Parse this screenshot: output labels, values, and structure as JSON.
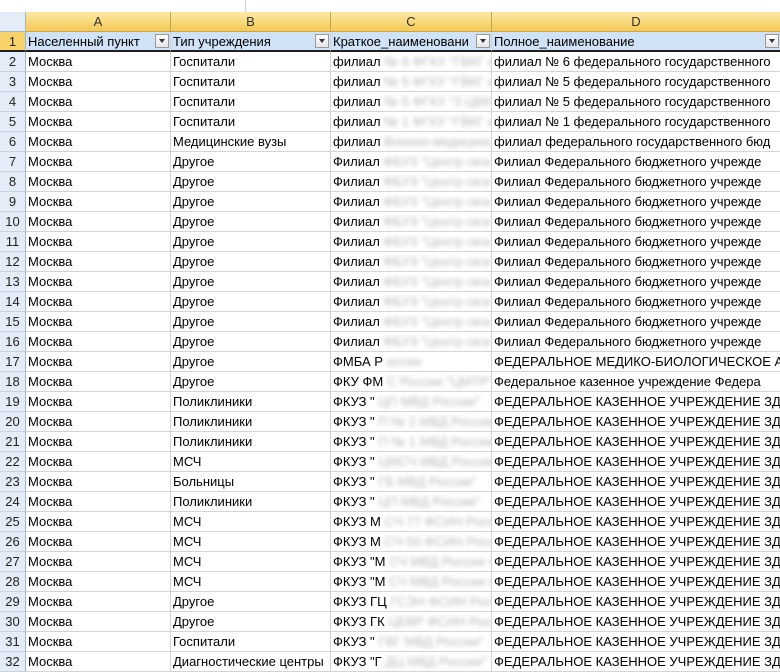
{
  "columns": [
    "A",
    "B",
    "C",
    "D"
  ],
  "headers": [
    "Населенный пункт",
    "Тип учреждения",
    "Краткое_наименовани",
    "Полное_наименование"
  ],
  "rows": [
    {
      "n": "2",
      "a": "Москва",
      "b": "Госпитали",
      "c": "филиал",
      "c_blur": "№ 6 ФГКУ \"ГВКГ и",
      "d": "филиал № 6 федерального государственного"
    },
    {
      "n": "3",
      "a": "Москва",
      "b": "Госпитали",
      "c": "филиал",
      "c_blur": "№ 5 ФГКУ \"ГВКГ и",
      "d": "филиал № 5 федерального государственного"
    },
    {
      "n": "4",
      "a": "Москва",
      "b": "Госпитали",
      "c": "филиал",
      "c_blur": "№ 5 ФГКУ \"3 ЦВКГ",
      "d": "филиал № 5 федерального государственного"
    },
    {
      "n": "5",
      "a": "Москва",
      "b": "Госпитали",
      "c": "филиал",
      "c_blur": "№ 1 ФГКУ \"ГВКГ и",
      "d": "филиал № 1 федерального государственного"
    },
    {
      "n": "6",
      "a": "Москва",
      "b": "Медицинские вузы",
      "c": "филиал",
      "c_blur": "Военно-медицинской",
      "d": "филиал федерального государственного бюд"
    },
    {
      "n": "7",
      "a": "Москва",
      "b": "Другое",
      "c": "Филиал",
      "c_blur": "ФБУЗ \"Центр гиги",
      "d": "Филиал Федерального бюджетного учрежде"
    },
    {
      "n": "8",
      "a": "Москва",
      "b": "Другое",
      "c": "Филиал",
      "c_blur": "ФБУЗ \"Центр гиги",
      "d": "Филиал Федерального бюджетного учрежде"
    },
    {
      "n": "9",
      "a": "Москва",
      "b": "Другое",
      "c": "Филиал",
      "c_blur": "ФБУЗ \"Центр гиги",
      "d": "Филиал Федерального бюджетного учрежде"
    },
    {
      "n": "10",
      "a": "Москва",
      "b": "Другое",
      "c": "Филиал",
      "c_blur": "ФБУЗ \"Центр гиги",
      "d": "Филиал Федерального бюджетного учрежде"
    },
    {
      "n": "11",
      "a": "Москва",
      "b": "Другое",
      "c": "Филиал",
      "c_blur": "ФБУЗ \"Центр гиги",
      "d": "Филиал Федерального бюджетного учрежде"
    },
    {
      "n": "12",
      "a": "Москва",
      "b": "Другое",
      "c": "Филиал",
      "c_blur": "ФБУЗ \"Центр гиги",
      "d": "Филиал Федерального бюджетного учрежде"
    },
    {
      "n": "13",
      "a": "Москва",
      "b": "Другое",
      "c": "Филиал",
      "c_blur": "ФБУЗ \"Центр гиги",
      "d": "Филиал Федерального бюджетного учрежде"
    },
    {
      "n": "14",
      "a": "Москва",
      "b": "Другое",
      "c": "Филиал",
      "c_blur": "ФБУЗ \"Центр гиги",
      "d": "Филиал Федерального бюджетного учрежде"
    },
    {
      "n": "15",
      "a": "Москва",
      "b": "Другое",
      "c": "Филиал",
      "c_blur": "ФБУЗ \"Центр гиги",
      "d": "Филиал Федерального бюджетного учрежде"
    },
    {
      "n": "16",
      "a": "Москва",
      "b": "Другое",
      "c": "Филиал",
      "c_blur": "ФБУЗ \"Центр гиги",
      "d": "Филиал Федерального бюджетного учрежде"
    },
    {
      "n": "17",
      "a": "Москва",
      "b": "Другое",
      "c": "ФМБА Р",
      "c_blur": "оссии",
      "d": "ФЕДЕРАЛЬНОЕ МЕДИКО-БИОЛОГИЧЕСКОЕ АГ"
    },
    {
      "n": "18",
      "a": "Москва",
      "b": "Другое",
      "c": "ФКУ ФМ",
      "c_blur": "С России \"ЦМТР\"",
      "d": "Федеральное казенное учреждение Федера"
    },
    {
      "n": "19",
      "a": "Москва",
      "b": "Поликлиники",
      "c": "ФКУЗ \"",
      "c_blur": "ЦП МВД России\"",
      "d": "ФЕДЕРАЛЬНОЕ КАЗЕННОЕ УЧРЕЖДЕНИЕ ЗДРА"
    },
    {
      "n": "20",
      "a": "Москва",
      "b": "Поликлиники",
      "c": "ФКУЗ \"",
      "c_blur": "П № 2 МВД России\"",
      "d": "ФЕДЕРАЛЬНОЕ КАЗЕННОЕ УЧРЕЖДЕНИЕ ЗДРА"
    },
    {
      "n": "21",
      "a": "Москва",
      "b": "Поликлиники",
      "c": "ФКУЗ \"",
      "c_blur": "П № 1 МВД России\"",
      "d": "ФЕДЕРАЛЬНОЕ КАЗЕННОЕ УЧРЕЖДЕНИЕ ЗДРА"
    },
    {
      "n": "22",
      "a": "Москва",
      "b": "МСЧ",
      "c": "ФКУЗ \"",
      "c_blur": "ЦМСЧ МВД России\"",
      "d": "ФЕДЕРАЛЬНОЕ КАЗЕННОЕ УЧРЕЖДЕНИЕ ЗДРА"
    },
    {
      "n": "23",
      "a": "Москва",
      "b": "Больницы",
      "c": "ФКУЗ \"",
      "c_blur": "ГБ МВД России\"",
      "d": "ФЕДЕРАЛЬНОЕ КАЗЕННОЕ УЧРЕЖДЕНИЕ ЗДРА"
    },
    {
      "n": "24",
      "a": "Москва",
      "b": "Поликлиники",
      "c": "ФКУЗ \"",
      "c_blur": "ЦП МВД России\"",
      "d": "ФЕДЕРАЛЬНОЕ КАЗЕННОЕ УЧРЕЖДЕНИЕ ЗДРА"
    },
    {
      "n": "25",
      "a": "Москва",
      "b": "МСЧ",
      "c": "ФКУЗ М",
      "c_blur": "СЧ-77 ФСИН России",
      "d": "ФЕДЕРАЛЬНОЕ КАЗЕННОЕ УЧРЕЖДЕНИЕ ЗДРА"
    },
    {
      "n": "26",
      "a": "Москва",
      "b": "МСЧ",
      "c": "ФКУЗ М",
      "c_blur": "СЧ-50 ФСИН России",
      "d": "ФЕДЕРАЛЬНОЕ КАЗЕННОЕ УЧРЕЖДЕНИЕ ЗДРА"
    },
    {
      "n": "27",
      "a": "Москва",
      "b": "МСЧ",
      "c": "ФКУЗ \"М",
      "c_blur": "СЧ МВД России по",
      "d": "ФЕДЕРАЛЬНОЕ КАЗЕННОЕ УЧРЕЖДЕНИЕ ЗДРА"
    },
    {
      "n": "28",
      "a": "Москва",
      "b": "МСЧ",
      "c": "ФКУЗ \"М",
      "c_blur": "СЧ МВД России по",
      "d": "ФЕДЕРАЛЬНОЕ КАЗЕННОЕ УЧРЕЖДЕНИЕ ЗДРА"
    },
    {
      "n": "29",
      "a": "Москва",
      "b": "Другое",
      "c": "ФКУЗ ГЦ",
      "c_blur": "ГСЭН ФСИН России",
      "d": "ФЕДЕРАЛЬНОЕ КАЗЕННОЕ УЧРЕЖДЕНИЕ ЗДРА"
    },
    {
      "n": "30",
      "a": "Москва",
      "b": "Другое",
      "c": "ФКУЗ ГК",
      "c_blur": "ЦЕВР ФСИН России",
      "d": "ФЕДЕРАЛЬНОЕ КАЗЕННОЕ УЧРЕЖДЕНИЕ ЗДРА"
    },
    {
      "n": "31",
      "a": "Москва",
      "b": "Госпитали",
      "c": "ФКУЗ  \"",
      "c_blur": "ГВГ МВД России\"",
      "d": "ФЕДЕРАЛЬНОЕ КАЗЕННОЕ УЧРЕЖДЕНИЕ ЗДРА"
    },
    {
      "n": "32",
      "a": "Москва",
      "b": "Диагностические центры",
      "c": "ФКУЗ \"Г",
      "c_blur": "ДЦ МВД России\"",
      "d": "ФЕДЕРАЛЬНОЕ КАЗЕННОЕ УЧРЕЖДЕНИЕ ЗДРА"
    }
  ],
  "colors": {
    "header_accent": "#f5c955",
    "row1_fill": "#cfe2f6",
    "row_header": "#e4ecf7"
  }
}
